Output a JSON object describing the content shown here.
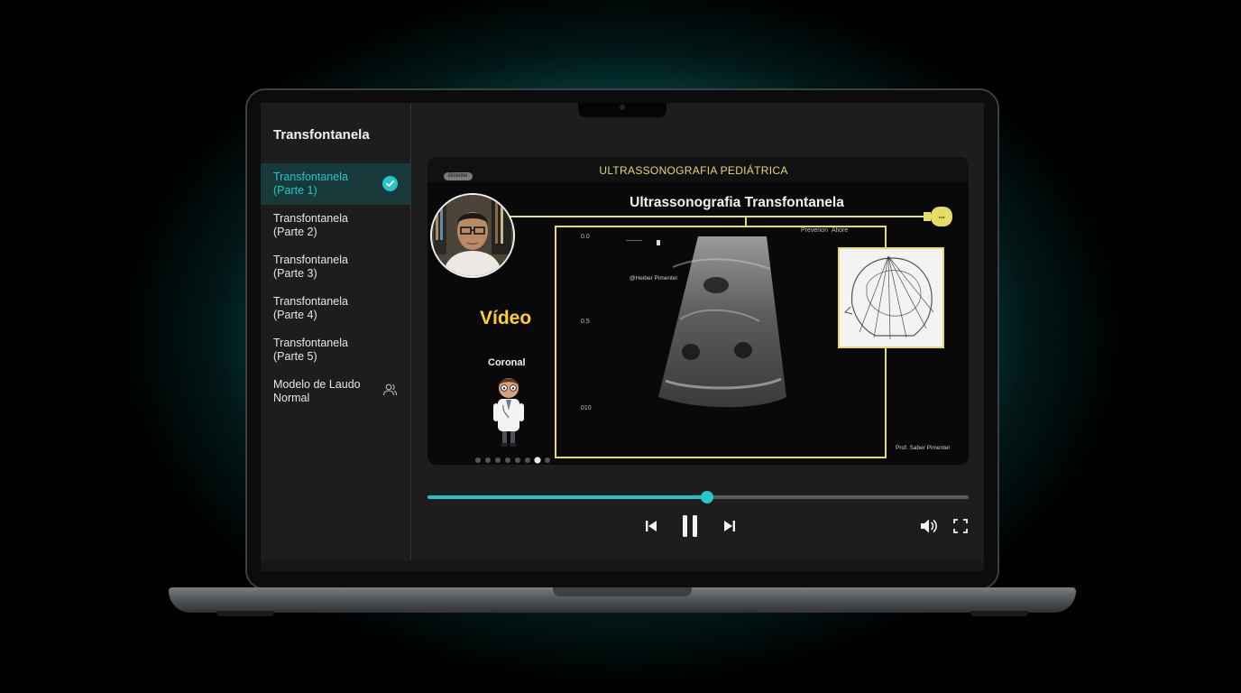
{
  "sidebar": {
    "title": "Transfontanela",
    "items": [
      {
        "label": "Transfontanela (Parte 1)",
        "state": "completed",
        "icon": "check-circle-icon"
      },
      {
        "label": "Transfontanela (Parte 2)"
      },
      {
        "label": "Transfontanela (Parte 3)"
      },
      {
        "label": "Transfontanela (Parte 4)"
      },
      {
        "label": "Transfontanela (Parte 5)"
      },
      {
        "label": "Modelo de Laudo Normal",
        "icon": "people-icon"
      }
    ]
  },
  "video": {
    "header": "ULTRASSONOGRAFIA PEDIÁTRICA",
    "tag": "Bildetter",
    "title": "Ultrassonografia Transfontanela",
    "side_label": "Vídeo",
    "view_label": "Coronal",
    "scale_marks": [
      "0.0",
      "0.5",
      "010"
    ],
    "scan_labels": [
      "Prevenon",
      "Afiore"
    ],
    "watermark": "@Heiber Pimentel",
    "credit": "Prof. Saber Pimentel"
  },
  "player": {
    "progress": 0.517,
    "controls": [
      "skip-back-icon",
      "pause-icon",
      "skip-forward-icon",
      "volume-icon",
      "fullscreen-icon"
    ]
  },
  "colors": {
    "accent": "#27c6c9",
    "video_header": "#e4d672",
    "video_label": "#ffd21f",
    "frame_border": "#e6dc63"
  }
}
